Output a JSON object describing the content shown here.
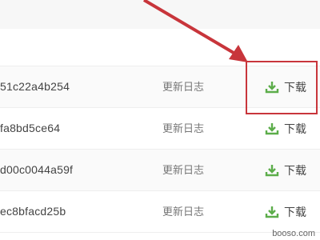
{
  "rows": [
    {
      "hash": "51c22a4b254",
      "changelog_label": "更新日志",
      "download_label": "下载"
    },
    {
      "hash": "fa8bd5ce64",
      "changelog_label": "更新日志",
      "download_label": "下载"
    },
    {
      "hash": "d00c0044a59f",
      "changelog_label": "更新日志",
      "download_label": "下载"
    },
    {
      "hash": "ec8bfacd25b",
      "changelog_label": "更新日志",
      "download_label": "下载"
    }
  ],
  "icons": {
    "download": "download-icon"
  },
  "colors": {
    "accent_green": "#5cad4a",
    "annotation_red": "#c8353b"
  },
  "watermark": "booso.com"
}
